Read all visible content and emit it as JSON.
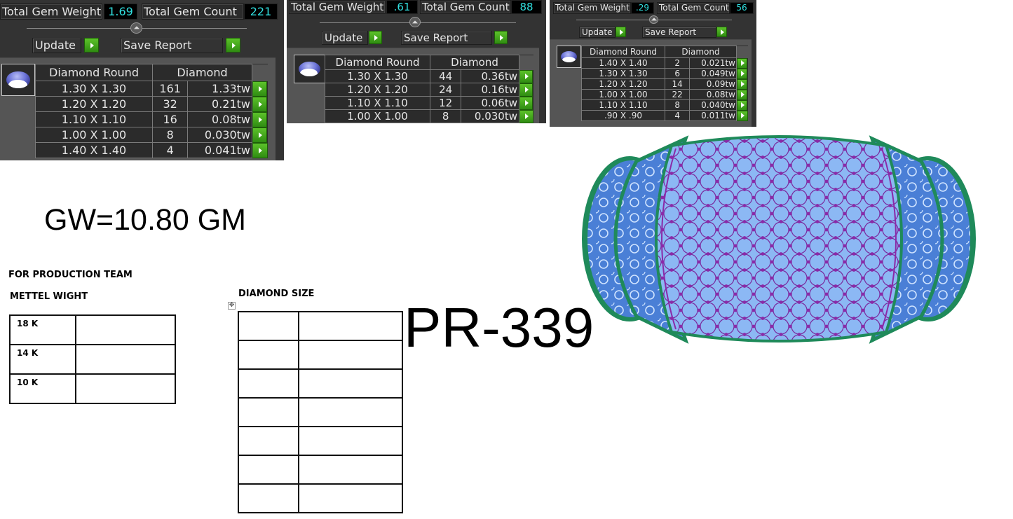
{
  "panels": [
    {
      "total_gem_weight_label": "Total Gem Weight",
      "total_gem_weight": "1.69",
      "total_gem_count_label": "Total Gem Count",
      "total_gem_count": "221",
      "update_label": "Update",
      "save_report_label": "Save Report",
      "table_header_shape": "Diamond Round",
      "table_header_material": "Diamond",
      "rows": [
        {
          "size": "1.30 X 1.30",
          "count": "161",
          "weight": "1.33tw"
        },
        {
          "size": "1.20 X 1.20",
          "count": "32",
          "weight": "0.21tw"
        },
        {
          "size": "1.10 X 1.10",
          "count": "16",
          "weight": "0.08tw"
        },
        {
          "size": "1.00 X 1.00",
          "count": "8",
          "weight": "0.030tw"
        },
        {
          "size": "1.40 X 1.40",
          "count": "4",
          "weight": "0.041tw"
        }
      ]
    },
    {
      "total_gem_weight_label": "Total Gem Weight",
      "total_gem_weight": ".61",
      "total_gem_count_label": "Total Gem Count",
      "total_gem_count": "88",
      "update_label": "Update",
      "save_report_label": "Save Report",
      "table_header_shape": "Diamond Round",
      "table_header_material": "Diamond",
      "rows": [
        {
          "size": "1.30 X 1.30",
          "count": "44",
          "weight": "0.36tw"
        },
        {
          "size": "1.20 X 1.20",
          "count": "24",
          "weight": "0.16tw"
        },
        {
          "size": "1.10 X 1.10",
          "count": "12",
          "weight": "0.06tw"
        },
        {
          "size": "1.00 X 1.00",
          "count": "8",
          "weight": "0.030tw"
        }
      ]
    },
    {
      "total_gem_weight_label": "Total Gem Weight",
      "total_gem_weight": ".29",
      "total_gem_count_label": "Total Gem Count",
      "total_gem_count": "56",
      "update_label": "Update",
      "save_report_label": "Save Report",
      "table_header_shape": "Diamond Round",
      "table_header_material": "Diamond",
      "rows": [
        {
          "size": "1.40 X 1.40",
          "count": "2",
          "weight": "0.021tw"
        },
        {
          "size": "1.30 X 1.30",
          "count": "6",
          "weight": "0.049tw"
        },
        {
          "size": "1.20 X 1.20",
          "count": "14",
          "weight": "0.09tw"
        },
        {
          "size": "1.00 X 1.00",
          "count": "22",
          "weight": "0.08tw"
        },
        {
          "size": "1.10 X 1.10",
          "count": "8",
          "weight": "0.040tw"
        },
        {
          "size": ".90 X .90",
          "count": "4",
          "weight": "0.011tw"
        }
      ]
    }
  ],
  "document": {
    "gross_weight": "GW=10.80 GM",
    "production_title": "FOR PRODUCTION TEAM",
    "metal_weight_title": "METTEL WIGHT",
    "metal_rows": [
      {
        "karat": "18 K",
        "value": ""
      },
      {
        "karat": "14 K",
        "value": ""
      },
      {
        "karat": "10 K",
        "value": ""
      }
    ],
    "diamond_size_title": "DIAMOND SIZE",
    "diamond_size_rows": 7,
    "product_code": "PR-339"
  },
  "ring_image": {
    "icon": "ring-render-icon",
    "colors": {
      "center_band": "#8ab4f0",
      "side_bands": "#4a7fd6",
      "prongs": "#8a2aa8",
      "edges": "#1f8a5a"
    }
  },
  "colors": {
    "panel_bg": "#333333",
    "panel_inner": "#555555",
    "value_text": "#31e0e0",
    "go_button": "#3fa51b"
  }
}
